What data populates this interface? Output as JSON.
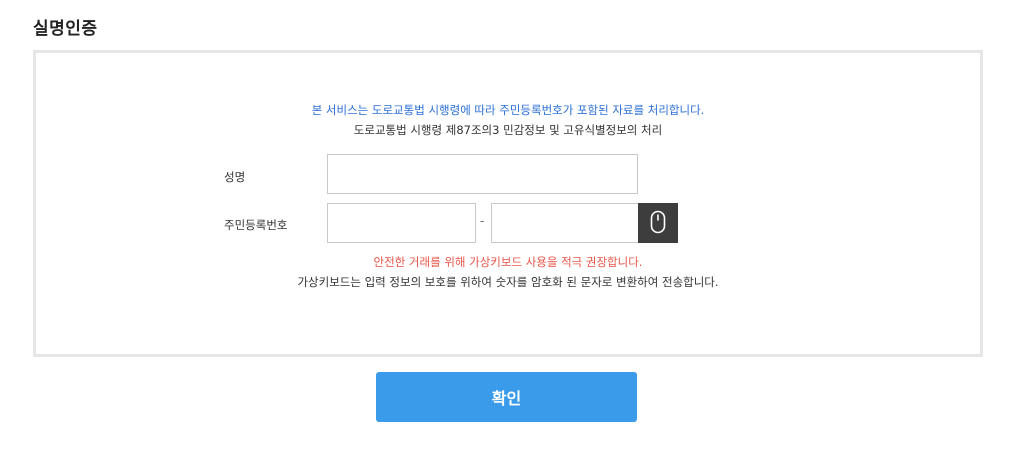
{
  "page": {
    "title": "실명인증"
  },
  "notice": {
    "main": "본 서비스는 도로교통법 시행령에 따라 주민등록번호가 포함된 자료를 처리합니다.",
    "sub": "도로교통법 시행령 제87조의3 민감정보 및 고유식별정보의 처리"
  },
  "form": {
    "name_label": "성명",
    "name_value": "",
    "rrn_label": "주민등록번호",
    "rrn_front_value": "",
    "rrn_separator": "-",
    "rrn_back_value": "",
    "virtual_keyboard_icon": "mouse-icon"
  },
  "messages": {
    "warning": "안전한 거래를 위해 가상키보드 사용을 적극 권장합니다.",
    "info": "가상키보드는 입력 정보의 보호를 위하여 숫자를 암호화 된 문자로 변환하여 전송합니다."
  },
  "actions": {
    "confirm_label": "확인"
  },
  "colors": {
    "notice_blue": "#2c6fd6",
    "warning_red": "#e8564a",
    "confirm_button": "#3a9bea",
    "keyboard_button": "#3d3d3d",
    "box_border": "#e6e6e6"
  }
}
